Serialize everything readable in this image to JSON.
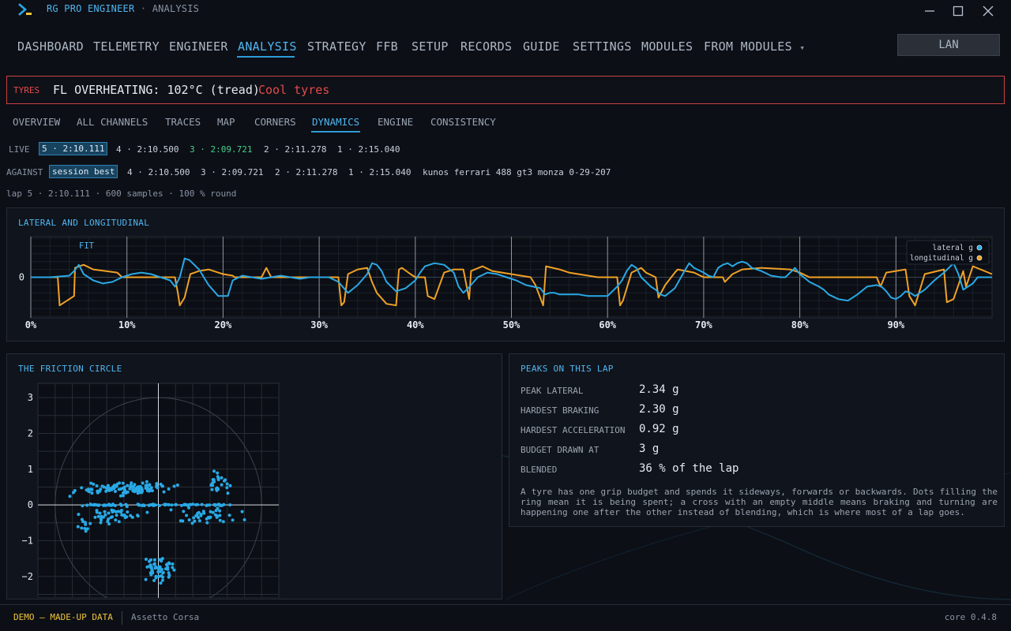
{
  "window": {
    "app_name": "RG PRO ENGINEER",
    "separator": "·",
    "section": "ANALYSIS",
    "icons": [
      "terminal-prompt-icon",
      "minimize-icon",
      "maximize-icon",
      "close-icon"
    ]
  },
  "nav": {
    "items": [
      "DASHBOARD",
      "TELEMETRY",
      "ENGINEER",
      "ANALYSIS",
      "STRATEGY",
      "FFB",
      "SETUP",
      "RECORDS",
      "GUIDE",
      "SETTINGS",
      "MODULES",
      "FROM MODULES"
    ],
    "active": "ANALYSIS",
    "dropdown_caret": "▾",
    "lan_button": "LAN"
  },
  "alert": {
    "tag": "TYRES",
    "message": "FL OVERHEATING: 102°C (tread)",
    "action": "Cool tyres",
    "color": "#e24b4b"
  },
  "subnav": {
    "items": [
      "OVERVIEW",
      "ALL CHANNELS",
      "TRACES",
      "MAP",
      "CORNERS",
      "DYNAMICS",
      "ENGINE",
      "CONSISTENCY"
    ],
    "active": "DYNAMICS"
  },
  "live": {
    "label": "LIVE",
    "laps": [
      "5 · 2:10.111",
      "4 · 2:10.500",
      "3 · 2:09.721",
      "2 · 2:11.278",
      "1 · 2:15.040"
    ],
    "selected": 0,
    "best": 2
  },
  "against": {
    "label": "AGAINST",
    "options": [
      "session best",
      "4 · 2:10.500",
      "3 · 2:09.721",
      "2 · 2:11.278",
      "1 · 2:15.040",
      "kunos ferrari 488 gt3 monza 0-29-207"
    ],
    "selected": 0
  },
  "lap_info": "lap 5 · 2:10.111 · 600 samples · 100 % round",
  "trace_panel": {
    "title": "LATERAL AND LONGITUDINAL",
    "fit_label": "FIT",
    "y_tick": "0",
    "x_ticks": [
      "0%",
      "10%",
      "20%",
      "30%",
      "40%",
      "50%",
      "60%",
      "70%",
      "80%",
      "90%"
    ],
    "legend": [
      "lateral g",
      "longitudinal g"
    ],
    "colors": {
      "lateral": "#29a9e6",
      "longitudinal": "#f0a126"
    }
  },
  "chart_data": [
    {
      "type": "line",
      "x_unit": "% of lap",
      "xlim": [
        0,
        100
      ],
      "ylim": [
        -2.6,
        2.6
      ],
      "series": [
        {
          "name": "lateral g",
          "x": [
            0,
            2,
            4,
            4.5,
            5,
            5.5,
            6.5,
            7.5,
            8.5,
            9.5,
            10.5,
            11.5,
            12.5,
            13.5,
            14.5,
            15,
            15.5,
            16,
            16.5,
            17.5,
            18.5,
            19.5,
            20.5,
            21,
            22,
            23,
            24,
            25,
            26,
            27,
            28,
            29,
            30,
            31,
            32,
            33,
            34,
            35,
            35.5,
            36,
            36.5,
            37,
            38,
            39,
            40,
            40.5,
            41,
            42,
            43,
            44,
            44.5,
            45,
            45.5,
            46.5,
            47.5,
            48.5,
            49.5,
            50.5,
            51.5,
            53,
            53.5,
            54,
            54.5,
            55,
            56,
            57,
            58,
            59,
            60,
            61,
            61.5,
            62,
            62.5,
            63,
            63.5,
            64,
            64.5,
            65,
            65.5,
            66,
            67,
            68,
            68.5,
            69,
            70,
            70.5,
            71,
            71.5,
            72,
            72.5,
            73,
            73.5,
            74,
            74.5,
            75,
            76,
            77,
            78,
            78.5,
            79,
            79.5,
            80,
            81,
            82,
            82.5,
            83,
            84,
            85,
            86,
            87,
            88,
            88.5,
            89,
            89.5,
            90,
            90.5,
            91,
            91.5,
            92,
            93,
            94,
            95,
            95.5,
            96,
            96.5,
            97,
            98,
            98.5,
            99,
            100
          ],
          "y": [
            0,
            0,
            0.1,
            0.4,
            0.8,
            0.2,
            -0.2,
            -0.4,
            -0.3,
            0,
            0.2,
            0.3,
            0.2,
            0,
            -0.2,
            -0.6,
            0,
            1.2,
            1.1,
            0.5,
            -0.5,
            -1.2,
            -1.2,
            -0.2,
            0.1,
            0,
            -0.1,
            0,
            0.1,
            0,
            -0.1,
            0,
            0,
            0,
            -0.3,
            -1,
            -0.5,
            0.2,
            0.9,
            0.8,
            0.4,
            -0.3,
            -0.9,
            -0.7,
            -0.2,
            0.3,
            0.7,
            0.9,
            0.8,
            0.3,
            -0.6,
            -1,
            -0.7,
            0,
            0.3,
            0.2,
            0,
            -0.2,
            -0.5,
            -0.7,
            -1.1,
            -1,
            -1,
            -1.1,
            -1.1,
            -1.1,
            -1.2,
            -1.2,
            -1.2,
            -0.6,
            -0.2,
            0.4,
            0.8,
            0.6,
            0,
            -0.3,
            -0.6,
            -0.8,
            -1.1,
            -1.2,
            -0.7,
            0.4,
            0.9,
            0.6,
            0.3,
            0.1,
            0,
            0.6,
            0.8,
            0.9,
            0.7,
            0.9,
            1,
            0.9,
            0.6,
            0.4,
            0.1,
            0,
            0,
            0.3,
            0.6,
            0.2,
            -0.3,
            -0.6,
            -0.8,
            -1.1,
            -1.4,
            -1.5,
            -1.1,
            -0.6,
            -0.5,
            -0.6,
            -0.9,
            -1.3,
            -1.4,
            -1.2,
            -0.9,
            -1,
            -1.2,
            -0.8,
            -0.2,
            0.3,
            0.6,
            0.9,
            0.2,
            -0.8,
            -0.4,
            0,
            0,
            0
          ],
          "color": "#29a9e6"
        },
        {
          "name": "longitudinal g",
          "x": [
            0,
            2,
            2.8,
            3,
            4.5,
            4.6,
            5.5,
            6.5,
            9,
            9.5,
            12,
            15,
            15.3,
            15.5,
            16,
            16.6,
            17.5,
            18.5,
            19.5,
            20,
            21,
            21.2,
            23,
            24,
            24.5,
            25,
            27,
            28,
            32,
            32.3,
            32.6,
            33,
            34,
            35,
            35.5,
            36,
            37,
            38,
            38.3,
            38.6,
            39.5,
            40,
            41,
            41.3,
            42,
            43,
            44,
            45,
            45.6,
            45.8,
            47,
            48,
            52,
            52.5,
            53.3,
            53.6,
            55,
            56,
            59,
            61,
            61.3,
            61.6,
            62.5,
            63.5,
            64,
            65,
            65.3,
            66,
            67,
            67.3,
            69,
            70,
            72,
            72.2,
            73,
            74,
            76,
            79,
            80,
            81,
            88,
            88.4,
            89,
            90,
            91,
            91.4,
            92,
            93,
            95,
            95.3,
            96,
            97,
            97.3,
            98,
            100
          ],
          "y": [
            0,
            0,
            0,
            -1.8,
            -1.2,
            0.6,
            0.8,
            0.5,
            0.3,
            0,
            0,
            0,
            -1,
            -1.8,
            -1.3,
            0.2,
            0.4,
            0.5,
            0.3,
            0.2,
            0.1,
            0,
            0,
            0,
            0.6,
            0,
            0,
            0,
            0,
            -1.8,
            -1.6,
            0.2,
            0.5,
            0.6,
            -0.3,
            -1,
            -1.7,
            -1.8,
            0.5,
            0.6,
            0.2,
            0,
            0,
            -1.2,
            -1.4,
            0.3,
            0.5,
            0.5,
            -1.4,
            0.4,
            0.7,
            0.4,
            0,
            -0.5,
            -1.8,
            0.7,
            0.5,
            0.3,
            0,
            0,
            -1.8,
            -1.5,
            0.3,
            0.6,
            0.3,
            0,
            -1.3,
            -0.5,
            0.3,
            0.5,
            0.3,
            0,
            0,
            -0.3,
            0.2,
            0.5,
            0.6,
            0.5,
            0.3,
            0,
            0,
            -0.6,
            0.3,
            0.4,
            0.5,
            -1.2,
            -1.8,
            0.2,
            0.5,
            -1.6,
            -1.4,
            0.4,
            -0.6,
            0.7,
            0.2
          ],
          "color": "#f0a126"
        }
      ]
    },
    {
      "type": "scatter",
      "title": "THE FRICTION CIRCLE",
      "xlim": [
        -3.5,
        3.5
      ],
      "ylim": [
        -2.6,
        3.4
      ],
      "y_ticks": [
        "3",
        "2",
        "1",
        "0",
        "−1",
        "−2"
      ],
      "budget_ring_g": 3,
      "series": [
        {
          "name": "",
          "color": "#29a9e6",
          "clusters": [
            {
              "x": -1.0,
              "y": 0.45,
              "sx": 1.4,
              "sy": 0.18,
              "n": 110
            },
            {
              "x": 0.0,
              "y": 0.0,
              "sx": 2.1,
              "sy": 0.02,
              "n": 80
            },
            {
              "x": 0.0,
              "y": -1.8,
              "sx": 0.4,
              "sy": 0.4,
              "n": 55
            },
            {
              "x": -1.4,
              "y": -0.3,
              "sx": 1.0,
              "sy": 0.25,
              "n": 45
            },
            {
              "x": 1.3,
              "y": -0.3,
              "sx": 1.0,
              "sy": 0.25,
              "n": 40
            },
            {
              "x": 1.7,
              "y": 0.6,
              "sx": 0.4,
              "sy": 0.3,
              "n": 25
            },
            {
              "x": -2.2,
              "y": -0.6,
              "sx": 0.2,
              "sy": 0.3,
              "n": 8
            }
          ]
        }
      ]
    }
  ],
  "friction_panel": {
    "title": "THE FRICTION CIRCLE"
  },
  "peaks": {
    "title": "PEAKS ON THIS LAP",
    "rows": [
      {
        "label": "PEAK LATERAL",
        "value": "2.34 g"
      },
      {
        "label": "HARDEST BRAKING",
        "value": "2.30 g"
      },
      {
        "label": "HARDEST ACCELERATION",
        "value": "0.92 g"
      },
      {
        "label": "BUDGET DRAWN AT",
        "value": "3 g"
      },
      {
        "label": "BLENDED",
        "value": "36 % of the lap"
      }
    ],
    "description": "A tyre has one grip budget and spends it sideways, forwards or backwards. Dots filling the ring mean it is being spent; a cross with an empty middle means braking and turning are happening one after the other instead of blending, which is where most of a lap goes."
  },
  "footer": {
    "demo": "DEMO — MADE-UP DATA",
    "game": "Assetto Corsa",
    "version": "core 0.4.8"
  }
}
